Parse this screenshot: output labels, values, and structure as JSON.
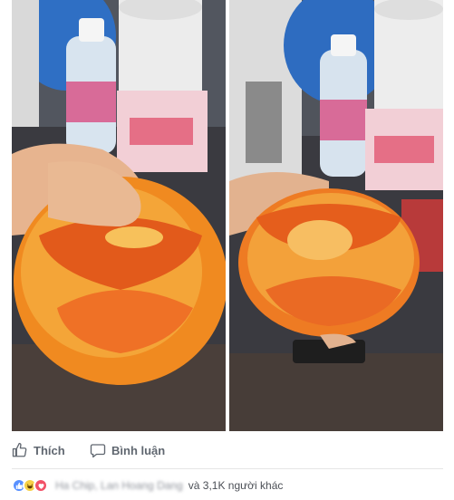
{
  "photos": [
    {
      "name": "left-photo"
    },
    {
      "name": "right-photo"
    }
  ],
  "actions": {
    "like_label": "Thích",
    "comment_label": "Bình luận"
  },
  "reactions": {
    "names_blurred": "Ha Chip, Lan Hoang Dang",
    "and_others": "và 3,1K người khác",
    "icons": [
      "like-icon",
      "haha-icon",
      "love-icon"
    ],
    "colors": {
      "like": "#5890ff",
      "haha": "#f7d046",
      "love": "#f25268"
    }
  }
}
